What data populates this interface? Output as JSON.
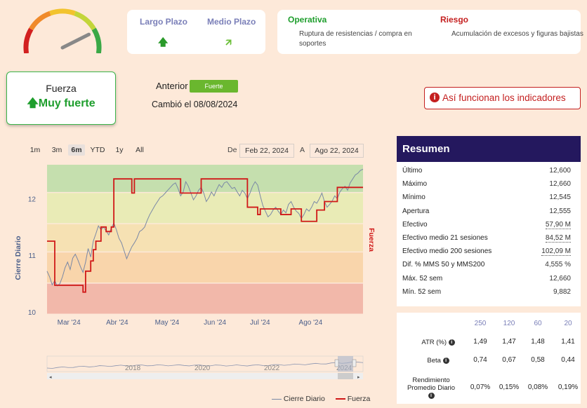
{
  "gauge": {
    "colors": [
      "#d22020",
      "#f08a2a",
      "#f2c32e",
      "#c3d53a",
      "#3aa846"
    ],
    "level": 0.82
  },
  "trend": {
    "long_label": "Largo Plazo",
    "long_arrow": "🡅",
    "medium_label": "Medio Plazo",
    "medium_arrow": "🡭"
  },
  "ops": {
    "operativa_title": "Operativa",
    "operativa_text": "Ruptura de resistencias / compra en soportes",
    "riesgo_title": "Riesgo",
    "riesgo_text": "Acumulación de excesos y figuras bajistas"
  },
  "force": {
    "title": "Fuerza",
    "value": "🡅Muy fuerte"
  },
  "previous": {
    "label": "Anterior",
    "badge": "Fuerte",
    "changed": "Cambió el 08/08/2024"
  },
  "howto": {
    "icon": "i",
    "label": "Así funcionan los indicadores"
  },
  "chart_controls": {
    "ranges": [
      "1m",
      "3m",
      "6m",
      "YTD",
      "1y",
      "All"
    ],
    "active": "6m",
    "from_label": "De",
    "from_value": "Feb 22, 2024",
    "to_label": "A",
    "to_value": "Ago 22, 2024"
  },
  "chart_data": {
    "type": "line",
    "ylabel_left": "Cierre Diario",
    "ylabel_right": "Fuerza",
    "yticks": [
      "12",
      "11",
      "10"
    ],
    "ylim": [
      9.95,
      12.6
    ],
    "xticks": [
      "Mar '24",
      "Abr '24",
      "May '24",
      "Jun '24",
      "Jul '24",
      "Ago '24"
    ],
    "bands": [
      {
        "from": 12.1,
        "to": 12.6,
        "color": "#c5dfae"
      },
      {
        "from": 11.55,
        "to": 12.1,
        "color": "#e9ebb6"
      },
      {
        "from": 11.05,
        "to": 11.55,
        "color": "#f6e1b3"
      },
      {
        "from": 10.5,
        "to": 11.05,
        "color": "#f9d5ab"
      },
      {
        "from": 9.95,
        "to": 10.5,
        "color": "#f2b8aa"
      }
    ],
    "series": [
      {
        "name": "Cierre Diario",
        "color": "#7a88a6",
        "values": [
          10.72,
          10.62,
          10.48,
          10.55,
          10.46,
          10.5,
          10.62,
          10.78,
          10.88,
          10.75,
          10.95,
          11.02,
          10.92,
          10.8,
          10.7,
          10.88,
          11.12,
          10.97,
          11.25,
          11.38,
          11.52,
          11.45,
          11.5,
          11.43,
          11.36,
          11.48,
          11.57,
          11.45,
          11.3,
          11.22,
          11.08,
          10.94,
          11.05,
          11.15,
          11.22,
          11.3,
          11.42,
          11.45,
          11.5,
          11.62,
          11.72,
          11.8,
          11.88,
          11.95,
          12.02,
          12.05,
          12.1,
          12.15,
          12.2,
          12.25,
          12.28,
          12.18,
          12.05,
          12.12,
          12.3,
          12.22,
          12.1,
          11.98,
          12.05,
          12.15,
          12.2,
          12.1,
          11.95,
          12.02,
          12.12,
          12.05,
          12.16,
          12.25,
          12.2,
          12.28,
          12.3,
          12.24,
          12.18,
          12.2,
          12.12,
          12.05,
          12.15,
          12.1,
          12.0,
          12.1,
          12.22,
          12.3,
          12.24,
          12.05,
          11.88,
          11.78,
          11.68,
          11.72,
          11.8,
          11.85,
          11.78,
          11.72,
          11.8,
          11.75,
          11.9,
          11.95,
          11.85,
          11.78,
          11.74,
          11.65,
          11.72,
          11.82,
          11.78,
          11.85,
          11.95,
          11.92,
          12.0,
          12.1,
          11.95,
          11.85,
          11.9,
          11.96,
          12.05,
          12.0,
          12.12,
          12.18,
          12.22,
          12.15,
          12.28,
          12.35,
          12.42,
          12.45,
          12.5,
          12.52
        ]
      },
      {
        "name": "Fuerza",
        "color": "#d01818",
        "values": [
          3,
          3,
          3,
          3,
          3,
          3,
          3,
          3,
          3,
          3,
          3,
          3,
          3,
          3,
          3,
          3,
          3,
          3,
          3,
          3,
          3,
          3,
          3,
          3,
          3,
          3,
          3,
          3,
          3,
          3,
          3,
          3,
          3,
          3,
          3,
          3,
          3,
          3,
          3,
          3,
          3,
          3,
          3,
          3,
          3,
          3,
          3,
          3,
          3,
          3,
          3,
          3,
          3,
          3,
          3,
          3,
          3,
          3,
          3,
          3,
          3,
          3,
          3,
          3,
          3,
          3,
          3,
          3,
          3,
          3,
          3,
          3,
          3,
          3,
          3,
          3,
          3,
          3,
          3,
          3,
          3,
          3,
          3,
          3,
          3,
          3,
          3,
          3,
          3,
          3,
          3,
          3,
          3,
          3,
          3,
          3,
          3,
          3,
          3,
          3,
          3,
          3,
          3,
          3,
          3,
          3,
          3,
          3,
          3,
          3,
          3,
          3,
          3,
          3,
          3,
          3,
          3,
          3,
          3,
          3,
          3,
          3,
          3,
          3
        ]
      }
    ],
    "fuerza_steps": [
      [
        0,
        11.25
      ],
      [
        3,
        11.25
      ],
      [
        3,
        10.47
      ],
      [
        14,
        10.47
      ],
      [
        14,
        10.35
      ],
      [
        15,
        10.35
      ],
      [
        15,
        10.72
      ],
      [
        17,
        10.72
      ],
      [
        17,
        10.9
      ],
      [
        18,
        10.9
      ],
      [
        18,
        11.1
      ],
      [
        19,
        11.1
      ],
      [
        19,
        11.25
      ],
      [
        21,
        11.25
      ],
      [
        21,
        11.5
      ],
      [
        23,
        11.5
      ],
      [
        23,
        11.42
      ],
      [
        25,
        11.42
      ],
      [
        25,
        11.5
      ],
      [
        26,
        11.5
      ],
      [
        26,
        12.35
      ],
      [
        33,
        12.35
      ],
      [
        33,
        12.1
      ],
      [
        34,
        12.1
      ],
      [
        34,
        12.35
      ],
      [
        52,
        12.35
      ],
      [
        52,
        12.1
      ],
      [
        60,
        12.1
      ],
      [
        60,
        12.35
      ],
      [
        78,
        12.35
      ],
      [
        78,
        11.85
      ],
      [
        82,
        11.85
      ],
      [
        82,
        11.72
      ],
      [
        83,
        11.72
      ],
      [
        83,
        11.82
      ],
      [
        91,
        11.82
      ],
      [
        91,
        11.72
      ],
      [
        95,
        11.72
      ],
      [
        95,
        11.82
      ],
      [
        99,
        11.82
      ],
      [
        99,
        11.6
      ],
      [
        105,
        11.6
      ],
      [
        105,
        11.8
      ],
      [
        108,
        11.8
      ],
      [
        108,
        11.95
      ],
      [
        113,
        11.95
      ],
      [
        113,
        12.2
      ],
      [
        123,
        12.2
      ]
    ],
    "navigator_years": [
      "2018",
      "2020",
      "2022",
      "2024"
    ]
  },
  "legend": {
    "items": [
      {
        "name": "Cierre Diario",
        "color": "#7a88a6"
      },
      {
        "name": "Fuerza",
        "color": "#d01818"
      }
    ]
  },
  "summary": {
    "title": "Resumen",
    "rows": [
      {
        "k": "Último",
        "v": "12,600"
      },
      {
        "k": "Máximo",
        "v": "12,660"
      },
      {
        "k": "Mínimo",
        "v": "12,545"
      },
      {
        "k": "Apertura",
        "v": "12,555"
      },
      {
        "k": "Efectivo",
        "v": "57,90 M"
      },
      {
        "k": "Efectivo medio 21 sesiones",
        "v": "84,52 M"
      },
      {
        "k": "Efectivo medio 200 sesiones",
        "v": "102,09 M"
      },
      {
        "k": "Dif. % MMS 50 y MMS200",
        "v": "4,555 %"
      },
      {
        "k": "Máx. 52 sem",
        "v": "12,660"
      },
      {
        "k": "Mín. 52 sem",
        "v": "9,882"
      }
    ]
  },
  "stats": {
    "headers": [
      "250",
      "120",
      "60",
      "20"
    ],
    "rows": [
      {
        "k": "ATR (%)",
        "vals": [
          "1,49",
          "1,47",
          "1,48",
          "1,41"
        ]
      },
      {
        "k": "Beta",
        "vals": [
          "0,74",
          "0,67",
          "0,58",
          "0,44"
        ]
      },
      {
        "k": "Rendimiento Promedio Diario",
        "vals": [
          "0,07%",
          "0,15%",
          "0,08%",
          "0,19%"
        ]
      }
    ]
  }
}
